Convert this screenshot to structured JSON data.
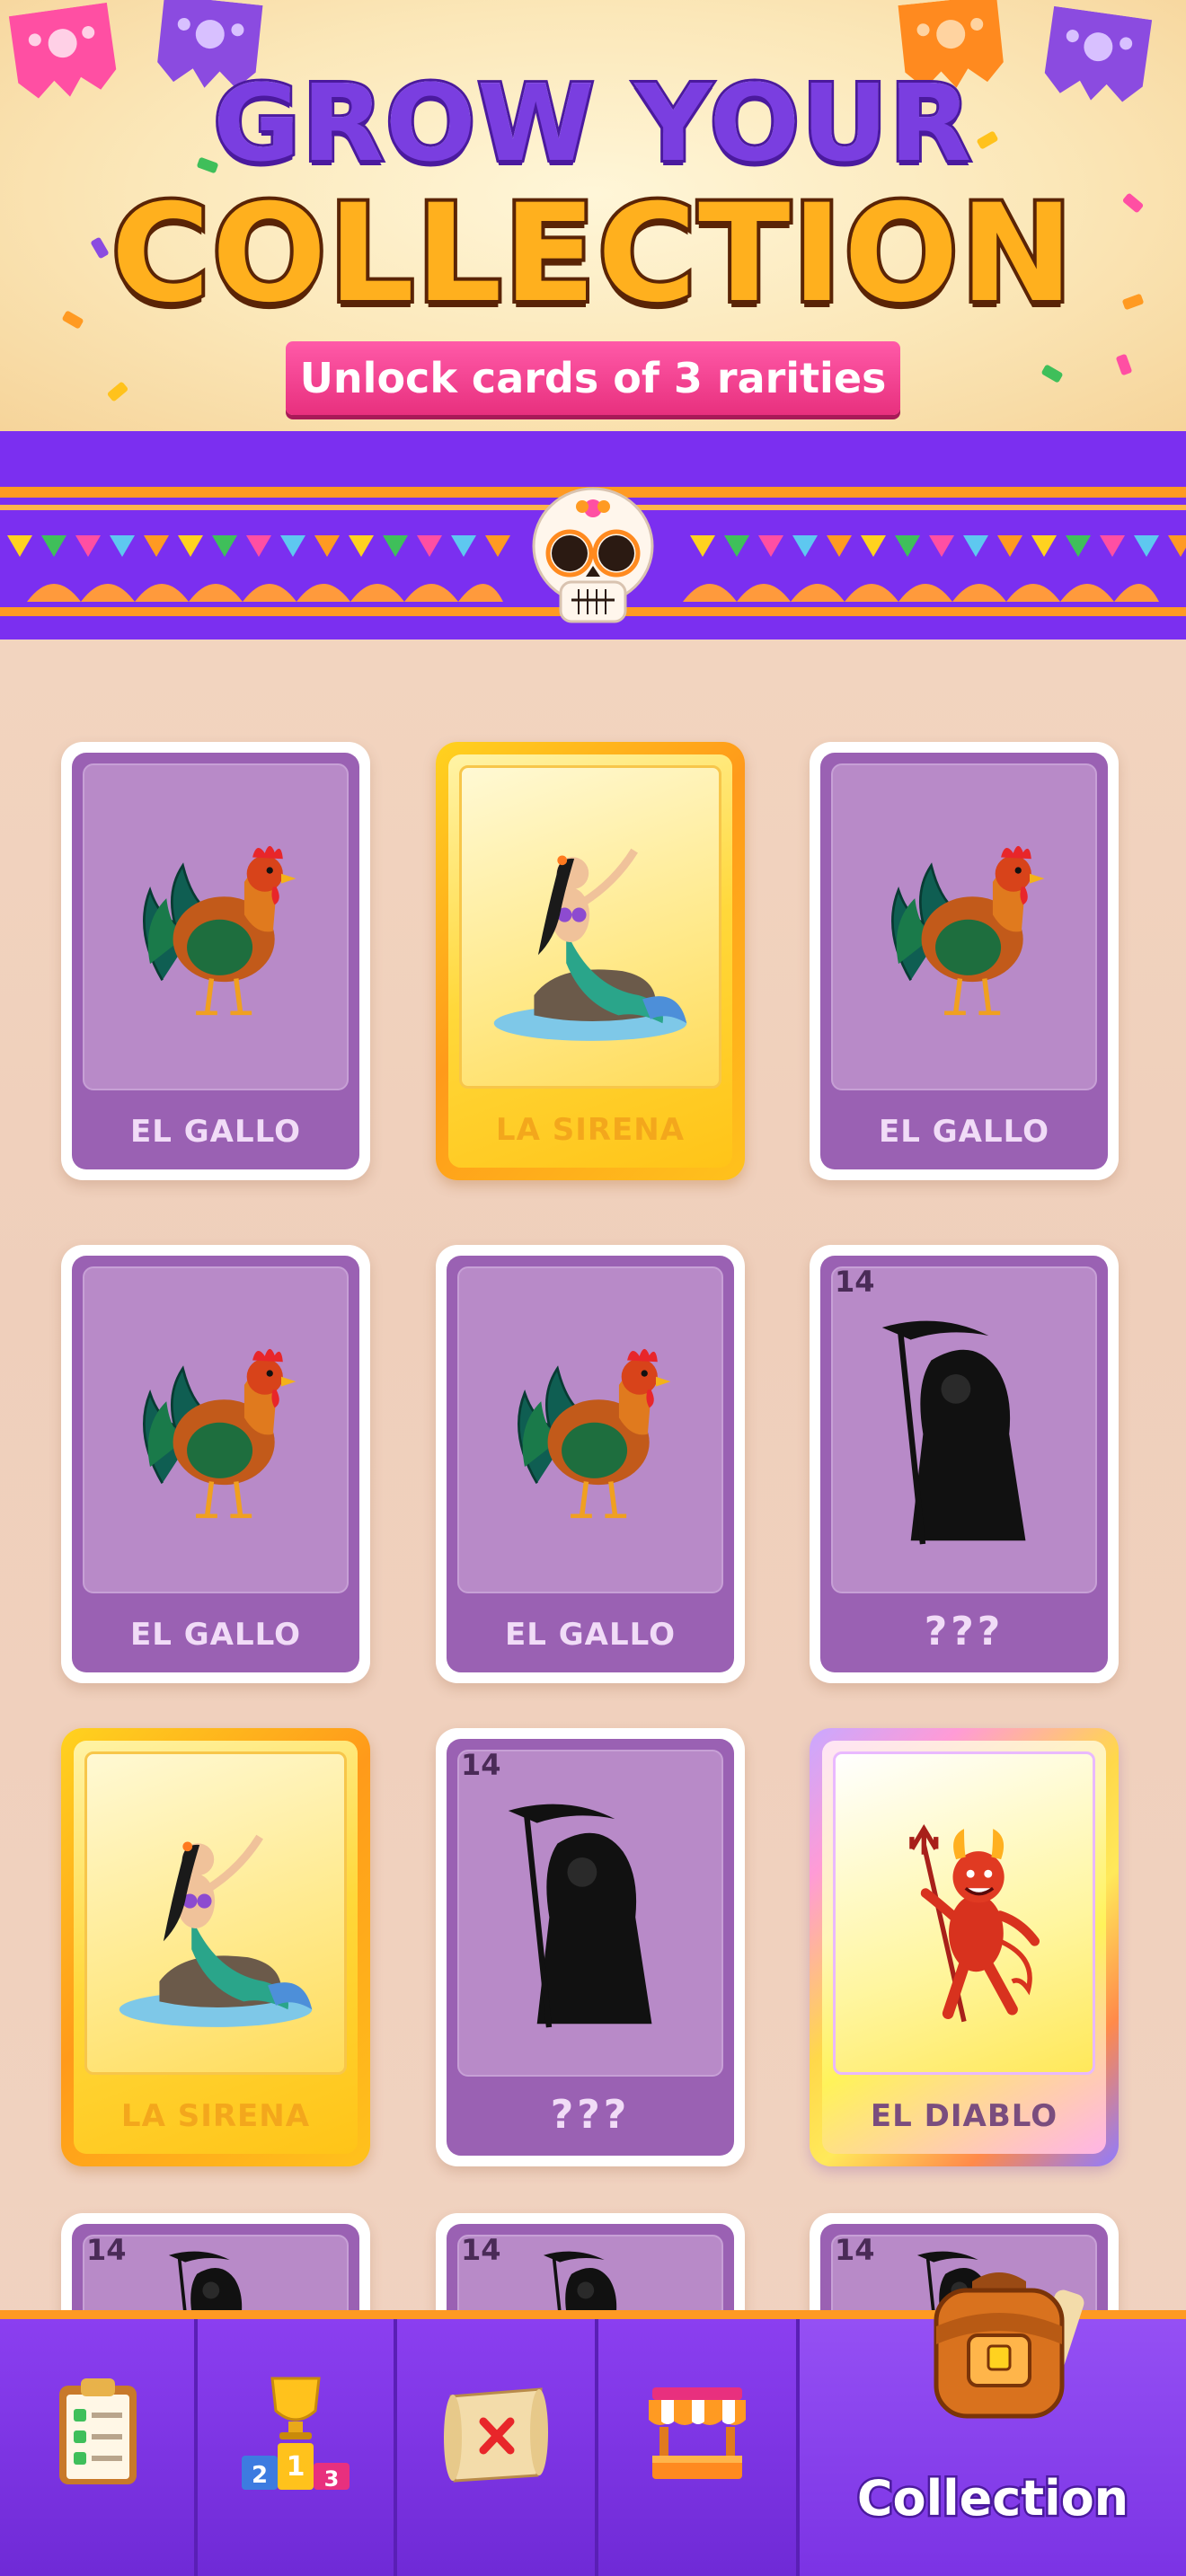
{
  "hero": {
    "title_line1": "GROW YOUR",
    "title_line2": "COLLECTION",
    "subtitle": "Unlock cards of 3 rarities"
  },
  "cards": [
    {
      "name": "EL GALLO",
      "rarity": "common",
      "figure": "rooster",
      "locked": false
    },
    {
      "name": "LA SIRENA",
      "rarity": "gold",
      "figure": "mermaid",
      "locked": false
    },
    {
      "name": "EL GALLO",
      "rarity": "common",
      "figure": "rooster",
      "locked": false
    },
    {
      "name": "EL GALLO",
      "rarity": "common",
      "figure": "rooster",
      "locked": false
    },
    {
      "name": "EL GALLO",
      "rarity": "common",
      "figure": "rooster",
      "locked": false
    },
    {
      "name": "???",
      "number": "14",
      "rarity": "common",
      "figure": "reaper-silhouette",
      "locked": true
    },
    {
      "name": "LA SIRENA",
      "rarity": "gold",
      "figure": "mermaid",
      "locked": false
    },
    {
      "name": "???",
      "number": "14",
      "rarity": "common",
      "figure": "reaper-silhouette",
      "locked": true
    },
    {
      "name": "EL DIABLO",
      "rarity": "rainbow",
      "figure": "devil",
      "locked": false
    },
    {
      "name": "",
      "number": "14",
      "rarity": "common",
      "figure": "reaper-silhouette",
      "locked": true
    },
    {
      "name": "",
      "number": "14",
      "rarity": "common",
      "figure": "reaper-silhouette",
      "locked": true
    },
    {
      "name": "",
      "number": "14",
      "rarity": "common",
      "figure": "reaper-silhouette",
      "locked": true
    }
  ],
  "nav": {
    "items": [
      {
        "id": "tasks",
        "icon": "clipboard-checklist-icon",
        "label": ""
      },
      {
        "id": "leaderboard",
        "icon": "trophy-podium-icon",
        "label": ""
      },
      {
        "id": "map",
        "icon": "treasure-map-icon",
        "label": ""
      },
      {
        "id": "shop",
        "icon": "shop-stall-icon",
        "label": ""
      },
      {
        "id": "collection",
        "icon": "backpack-icon",
        "label": "Collection",
        "active": true
      }
    ],
    "podium_numbers": [
      "2",
      "1",
      "3"
    ]
  },
  "colors": {
    "purple": "#7b2ff0",
    "orange": "#ff9a22",
    "gold": "#ffc21c",
    "pink": "#e8307e"
  }
}
